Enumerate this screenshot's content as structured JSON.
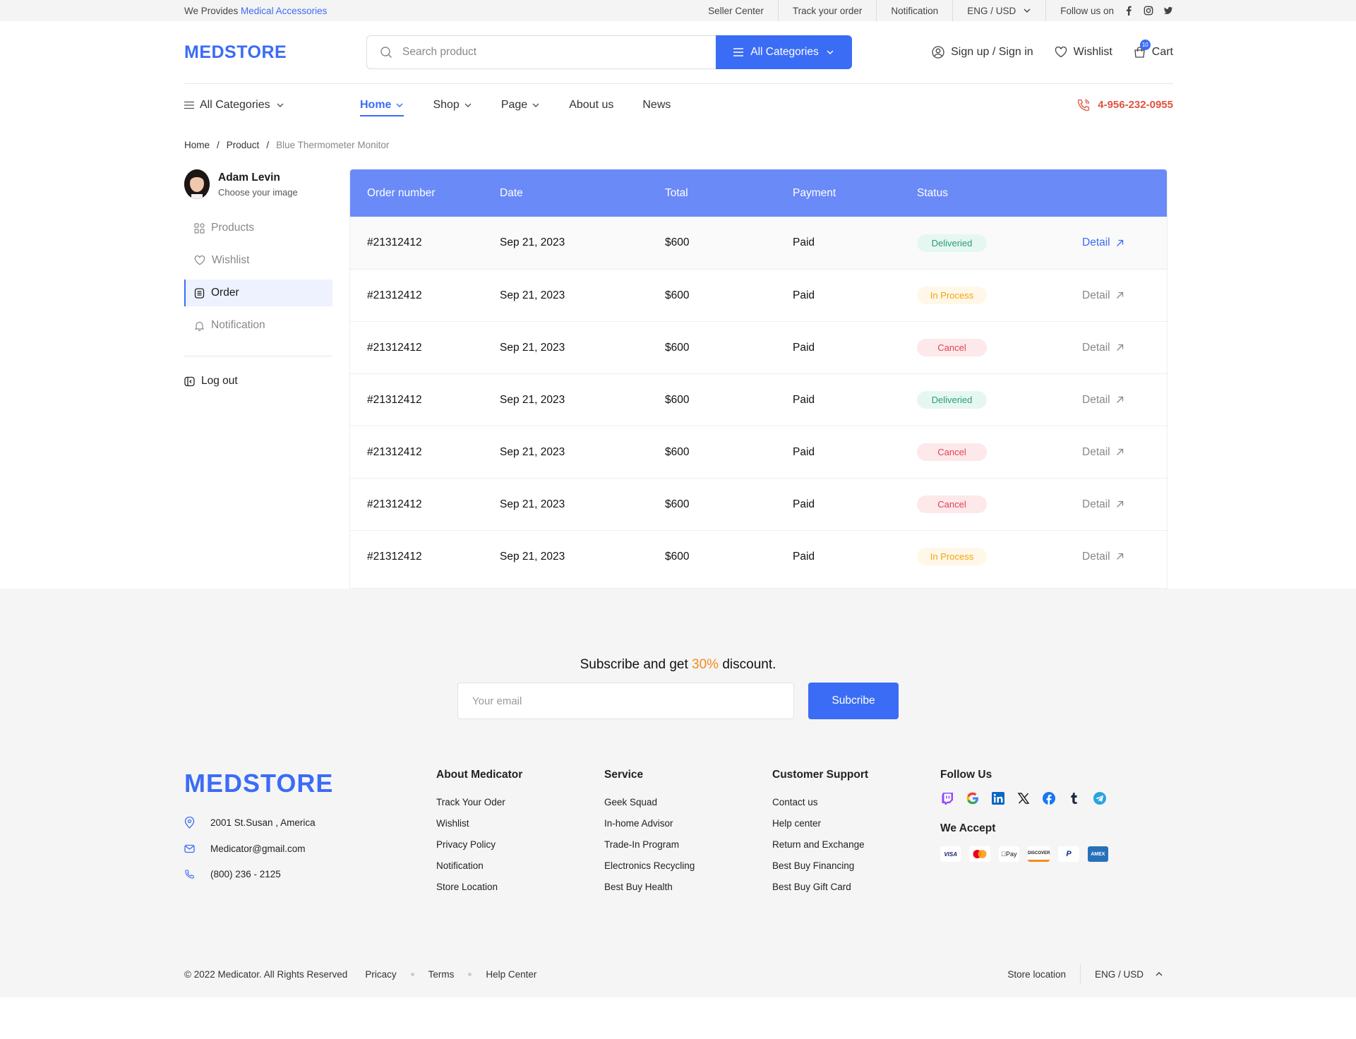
{
  "topbar": {
    "promo_prefix": "We Provides",
    "promo_accent": "Medical Accessories",
    "links": [
      "Seller Center",
      "Track your order",
      "Notification"
    ],
    "language": "ENG / USD",
    "follow_label": "Follow us on",
    "social_icons": [
      "facebook-icon",
      "instagram-icon",
      "twitter-icon"
    ]
  },
  "header": {
    "logo": "MEDSTORE",
    "search_placeholder": "Search product",
    "category_button": "All Categories",
    "signin": "Sign up / Sign in",
    "wishlist": "Wishlist",
    "cart": "Cart",
    "cart_count": "10"
  },
  "nav": {
    "all_categories": "All Categories",
    "items": [
      "Home",
      "Shop",
      "Page",
      "About us",
      "News"
    ],
    "active": "Home",
    "phone": "4-956-232-0955"
  },
  "breadcrumb": [
    "Home",
    "Product",
    "Blue Thermometer Monitor"
  ],
  "sidebar": {
    "user_name": "Adam Levin",
    "user_sub": "Choose your image",
    "items": [
      "Products",
      "Wishlist",
      "Order",
      "Notification"
    ],
    "active": "Order",
    "logout": "Log out"
  },
  "orders": {
    "columns": [
      "Order number",
      "Date",
      "Total",
      "Payment",
      "Status"
    ],
    "detail_label": "Detail",
    "rows": [
      {
        "number": "#21312412",
        "date": "Sep 21, 2023",
        "total": "$600",
        "payment": "Paid",
        "status": "Deliveried",
        "kind": "deliv"
      },
      {
        "number": "#21312412",
        "date": "Sep 21, 2023",
        "total": "$600",
        "payment": "Paid",
        "status": "In Process",
        "kind": "proc"
      },
      {
        "number": "#21312412",
        "date": "Sep 21, 2023",
        "total": "$600",
        "payment": "Paid",
        "status": "Cancel",
        "kind": "canc"
      },
      {
        "number": "#21312412",
        "date": "Sep 21, 2023",
        "total": "$600",
        "payment": "Paid",
        "status": "Deliveried",
        "kind": "deliv"
      },
      {
        "number": "#21312412",
        "date": "Sep 21, 2023",
        "total": "$600",
        "payment": "Paid",
        "status": "Cancel",
        "kind": "canc"
      },
      {
        "number": "#21312412",
        "date": "Sep 21, 2023",
        "total": "$600",
        "payment": "Paid",
        "status": "Cancel",
        "kind": "canc"
      },
      {
        "number": "#21312412",
        "date": "Sep 21, 2023",
        "total": "$600",
        "payment": "Paid",
        "status": "In Process",
        "kind": "proc"
      }
    ]
  },
  "subscribe": {
    "prefix": "Subscribe and get",
    "accent": "30%",
    "suffix": "discount.",
    "placeholder": "Your email",
    "button": "Subcribe"
  },
  "footer": {
    "logo": "MEDSTORE",
    "address": "2001 St.Susan , America",
    "email": "Medicator@gmail.com",
    "phone": "(800) 236 - 2125",
    "columns": [
      {
        "title": "About Medicator",
        "links": [
          "Track Your Oder",
          "Wishlist",
          "Privacy Policy",
          "Notification",
          "Store Location"
        ]
      },
      {
        "title": "Service",
        "links": [
          "Geek Squad",
          "In-home Advisor",
          "Trade-In Program",
          "Electronics Recycling",
          "Best Buy Health"
        ]
      },
      {
        "title": "Customer Support",
        "links": [
          "Contact us",
          "Help center",
          "Return and Exchange",
          "Best Buy Financing",
          "Best Buy Gift Card"
        ]
      }
    ],
    "follow_title": "Follow Us",
    "accept_title": "We Accept",
    "social_icons": [
      "twitch-icon",
      "google-icon",
      "linkedin-icon",
      "x-icon",
      "facebook-icon",
      "tumblr-icon",
      "telegram-icon"
    ],
    "payment_icons": [
      "visa-icon",
      "mastercard-icon",
      "applepay-icon",
      "discover-icon",
      "paypal-icon",
      "amex-icon"
    ],
    "payment_labels": [
      "VISA",
      "",
      "Pay",
      "DISCOVER",
      "P",
      "AMEX"
    ],
    "copyright": "© 2022 Medicator. All Rights Reserved",
    "bottom_links": [
      "Pricacy",
      "Terms",
      "Help Center"
    ],
    "store_location": "Store location",
    "language": "ENG / USD"
  },
  "colors": {
    "accent": "#3b6cf6",
    "table_header": "#6a8af8",
    "phone": "#e0533f",
    "discount": "#f28c1b"
  }
}
